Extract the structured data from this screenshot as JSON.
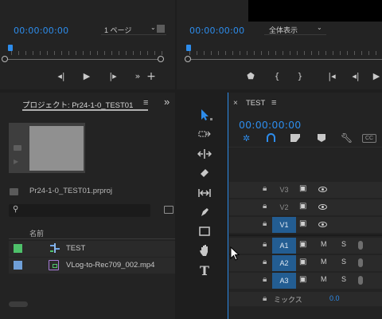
{
  "source_monitor": {
    "timecode": "00:00:00:00",
    "page_select": "1 ページ"
  },
  "program_monitor": {
    "timecode": "00:00:00:00",
    "view_select": "全体表示"
  },
  "project": {
    "tab_title": "プロジェクト: Pr24-1-0_TEST01",
    "menu_icon": "≡",
    "expand_icon": "»",
    "file_name": "Pr24-1-0_TEST01.prproj",
    "search_placeholder": "",
    "column_name": "名前",
    "items": [
      {
        "name": "TEST",
        "icon": "sequence-icon",
        "color": "#4ec16a"
      },
      {
        "name": "VLog-to-Rec709_002.mp4",
        "icon": "media-clip-icon",
        "color": "#6f9fd8"
      }
    ]
  },
  "timeline": {
    "close": "×",
    "tab_title": "TEST",
    "menu_icon": "≡",
    "timecode": "00:00:00:00",
    "cc": "CC",
    "tracks_video": [
      "V3",
      "V2",
      "V1"
    ],
    "tracks_audio": [
      "A1",
      "A2",
      "A3"
    ],
    "mute": "M",
    "solo": "S",
    "mix_label": "ミックス",
    "mix_value": "0.0"
  },
  "colors": {
    "timecode": "#2d8ceb",
    "track_active": "#235d92",
    "selection_tool": "#2d8ceb"
  }
}
